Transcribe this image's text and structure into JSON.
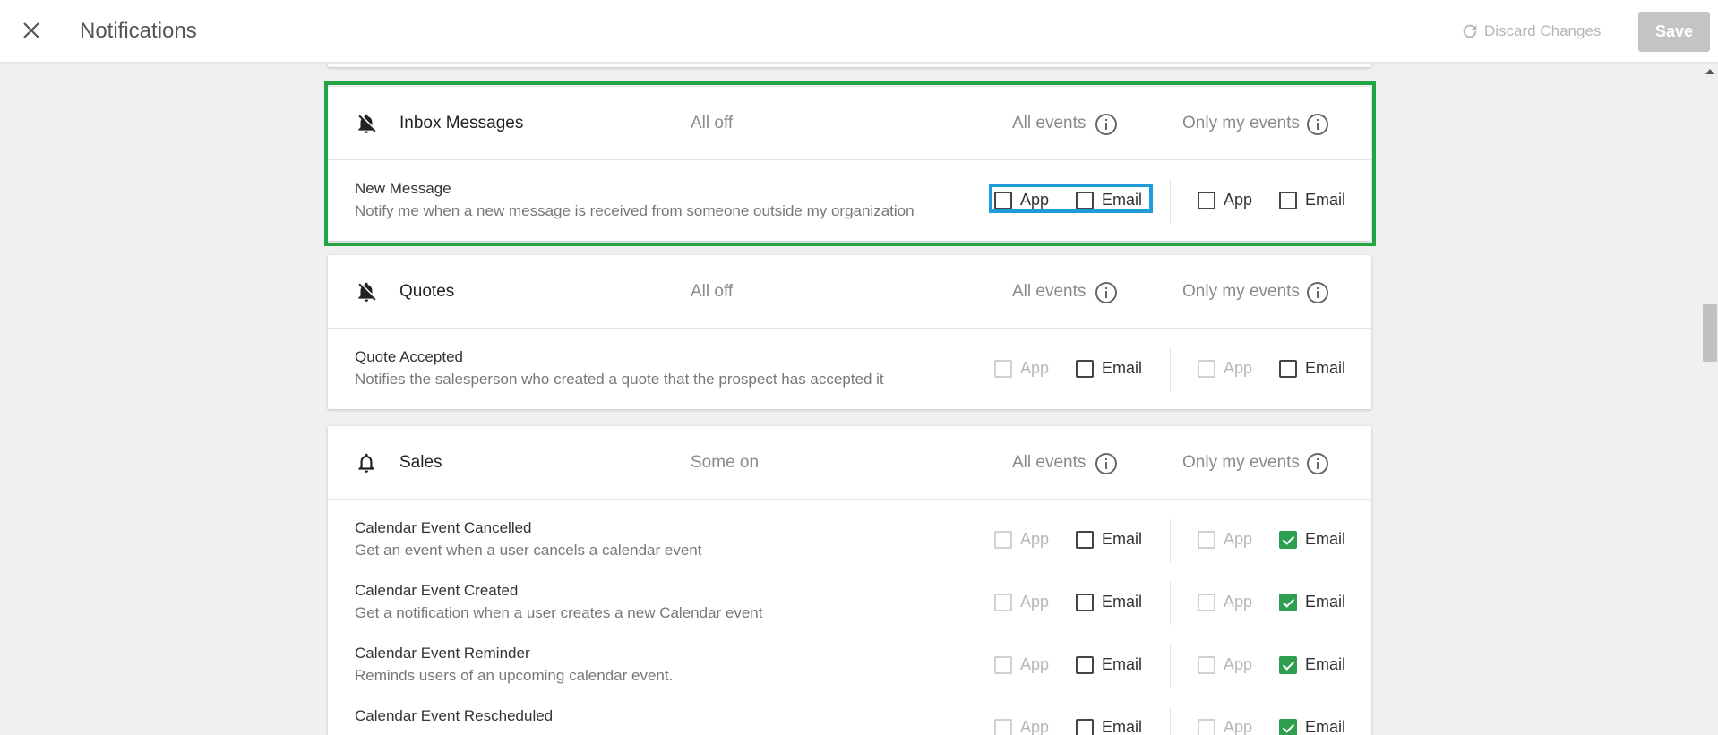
{
  "header": {
    "title": "Notifications",
    "discard_label": "Discard Changes",
    "save_label": "Save"
  },
  "columns": {
    "all_events": "All events",
    "only_my_events": "Only my events",
    "app": "App",
    "email": "Email"
  },
  "sections": [
    {
      "title": "Inbox Messages",
      "status": "All off",
      "bell": "bell-off-icon",
      "rows": [
        {
          "title": "New Message",
          "desc": "Notify me when a new message is received from someone outside my organization",
          "all_app": {
            "checked": false,
            "disabled": false
          },
          "all_email": {
            "checked": false,
            "disabled": false
          },
          "mine_app": {
            "checked": false,
            "disabled": false
          },
          "mine_email": {
            "checked": false,
            "disabled": false
          }
        }
      ]
    },
    {
      "title": "Quotes",
      "status": "All off",
      "bell": "bell-off-icon",
      "rows": [
        {
          "title": "Quote Accepted",
          "desc": "Notifies the salesperson who created a quote that the prospect has accepted it",
          "all_app": {
            "checked": false,
            "disabled": true
          },
          "all_email": {
            "checked": false,
            "disabled": false
          },
          "mine_app": {
            "checked": false,
            "disabled": true
          },
          "mine_email": {
            "checked": false,
            "disabled": false
          }
        }
      ]
    },
    {
      "title": "Sales",
      "status": "Some on",
      "bell": "bell-icon",
      "rows": [
        {
          "title": "Calendar Event Cancelled",
          "desc": "Get an event when a user cancels a calendar event",
          "all_app": {
            "checked": false,
            "disabled": true
          },
          "all_email": {
            "checked": false,
            "disabled": false
          },
          "mine_app": {
            "checked": false,
            "disabled": true
          },
          "mine_email": {
            "checked": true,
            "disabled": false
          }
        },
        {
          "title": "Calendar Event Created",
          "desc": "Get a notification when a user creates a new Calendar event",
          "all_app": {
            "checked": false,
            "disabled": true
          },
          "all_email": {
            "checked": false,
            "disabled": false
          },
          "mine_app": {
            "checked": false,
            "disabled": true
          },
          "mine_email": {
            "checked": true,
            "disabled": false
          }
        },
        {
          "title": "Calendar Event Reminder",
          "desc": "Reminds users of an upcoming calendar event.",
          "all_app": {
            "checked": false,
            "disabled": true
          },
          "all_email": {
            "checked": false,
            "disabled": false
          },
          "mine_app": {
            "checked": false,
            "disabled": true
          },
          "mine_email": {
            "checked": true,
            "disabled": false
          }
        },
        {
          "title": "Calendar Event Rescheduled",
          "desc": "",
          "all_app": {
            "checked": false,
            "disabled": true
          },
          "all_email": {
            "checked": false,
            "disabled": false
          },
          "mine_app": {
            "checked": false,
            "disabled": true
          },
          "mine_email": {
            "checked": true,
            "disabled": false
          }
        }
      ]
    }
  ],
  "colors": {
    "highlight_section": "#21a444",
    "highlight_checkbox_group": "#1f9bd7",
    "checked": "#2e9e4f"
  }
}
